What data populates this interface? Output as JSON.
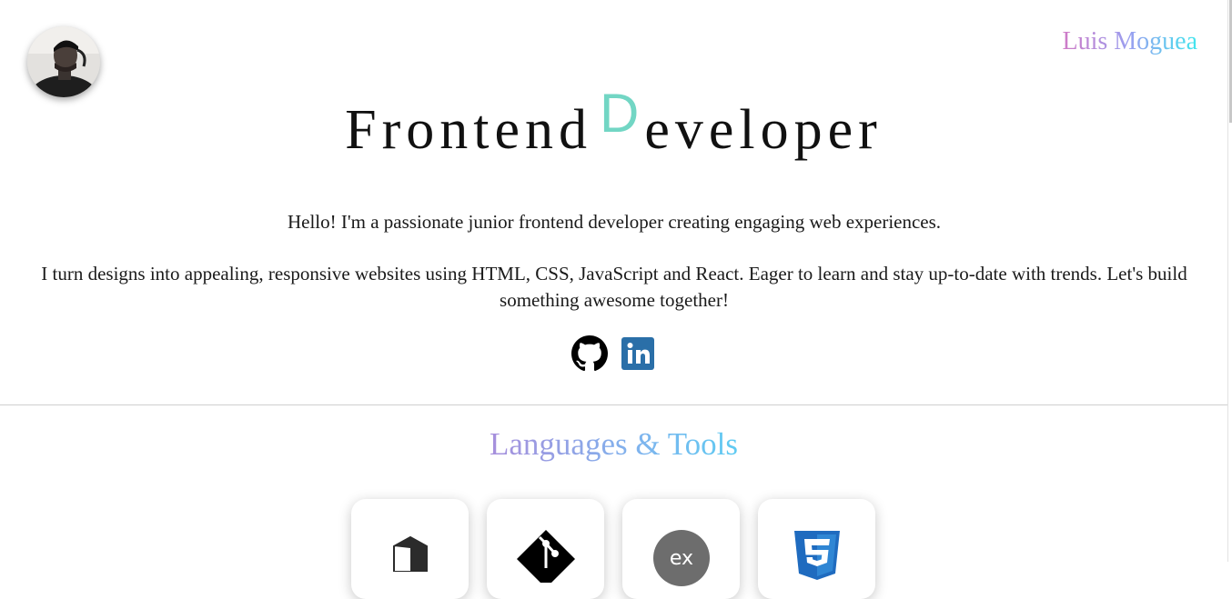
{
  "header": {
    "avatar_icon": "profile-photo",
    "brand_name": "Luis Moguea",
    "brand_gradient": [
      "#d07ac6",
      "#9a9ff0",
      "#40e6ee"
    ]
  },
  "hero": {
    "title_part1": "Frontend",
    "title_accent": "D",
    "title_part2": "eveloper",
    "accent_color": "#72d6c4",
    "intro_line1": "Hello! I'm a passionate junior frontend developer creating engaging web experiences.",
    "intro_line2": "I turn designs into appealing, responsive websites using HTML, CSS, JavaScript and React. Eager to learn and stay up-to-date with trends. Let's build something awesome together!",
    "socials": [
      {
        "icon": "github-icon"
      },
      {
        "icon": "linkedin-icon",
        "color": "#2a6fa8"
      }
    ]
  },
  "skills": {
    "title": "Languages & Tools",
    "title_gradient": [
      "#a78fdc",
      "#5ecbf2"
    ],
    "tools": [
      {
        "icon": "bash-icon"
      },
      {
        "icon": "git-icon"
      },
      {
        "icon": "express-icon"
      },
      {
        "icon": "css3-icon",
        "color": "#1f6bbf"
      }
    ]
  }
}
